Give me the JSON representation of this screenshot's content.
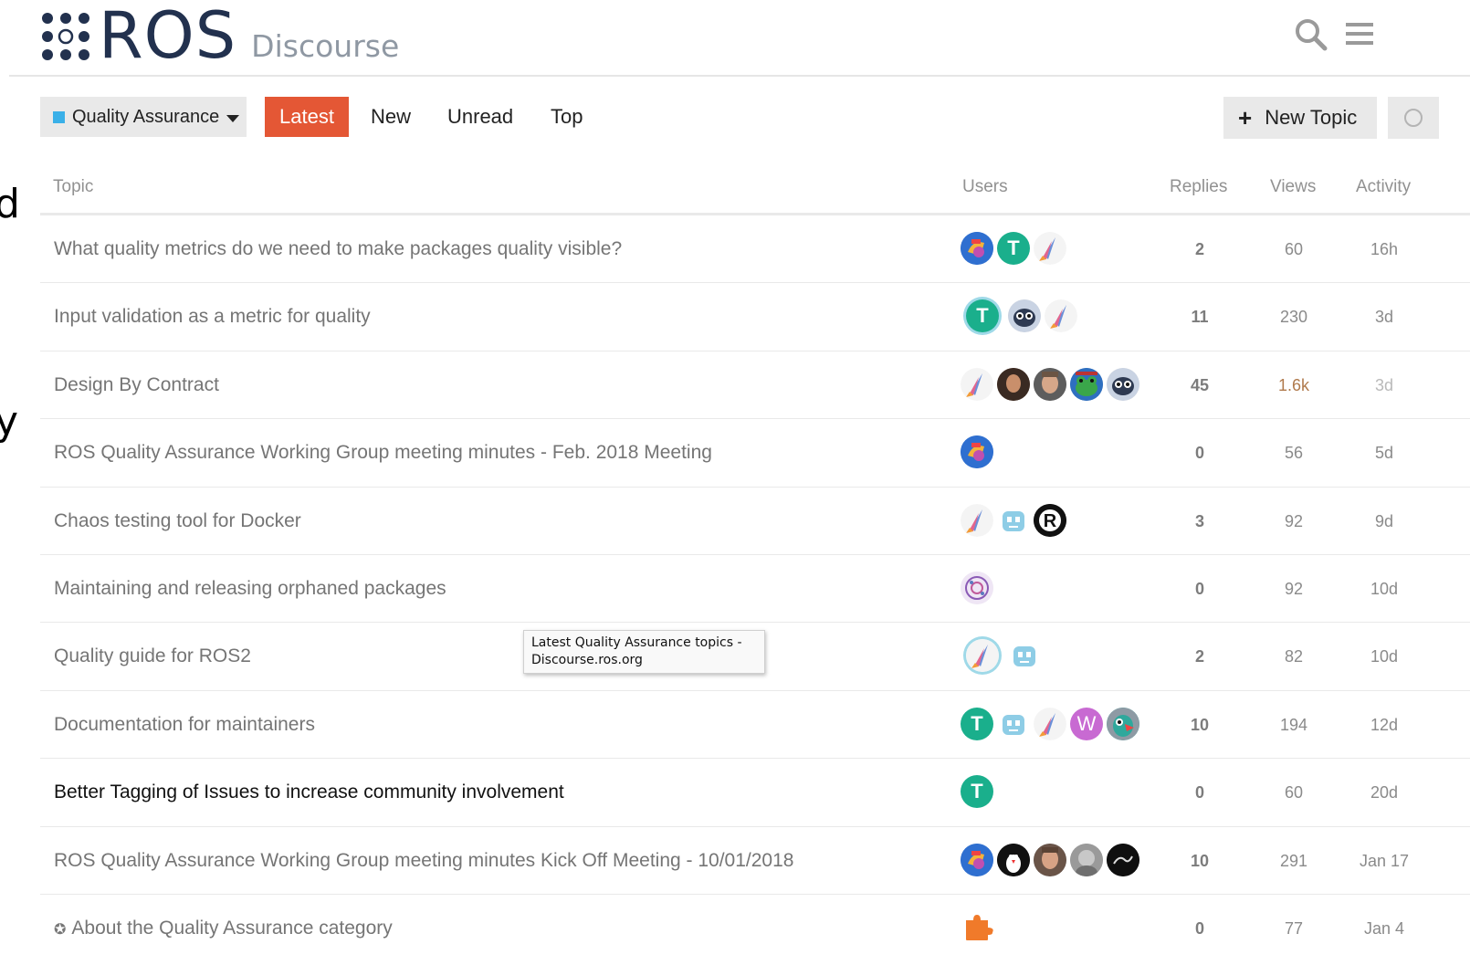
{
  "header": {
    "logo_text": "ROS",
    "logo_subtext": "Discourse",
    "search_icon": "search-icon",
    "menu_icon": "hamburger-menu-icon"
  },
  "nav": {
    "category": {
      "label": "Quality Assurance",
      "color": "#3ab0e8"
    },
    "tabs": [
      "Latest",
      "New",
      "Unread",
      "Top"
    ],
    "active_tab": "Latest",
    "active_color": "#e45735",
    "new_topic_label": "New Topic"
  },
  "table": {
    "headers": {
      "topic": "Topic",
      "users": "Users",
      "replies": "Replies",
      "views": "Views",
      "activity": "Activity"
    },
    "rows": [
      {
        "title": "What quality metrics do we need to make packages quality visible?",
        "replies": "2",
        "views": "60",
        "activity": "16h",
        "avatars": [
          "bird",
          "T",
          "rocket"
        ]
      },
      {
        "title": "Input validation as a metric for quality",
        "replies": "11",
        "views": "230",
        "activity": "3d",
        "avatars": [
          "T",
          "robot-face",
          "rocket"
        ]
      },
      {
        "title": "Design By Contract",
        "replies": "45",
        "views": "1.6k",
        "activity": "3d",
        "avatars": [
          "rocket",
          "person-dark",
          "person",
          "frog",
          "robot-face"
        ]
      },
      {
        "title": "ROS Quality Assurance Working Group meeting minutes - Feb. 2018 Meeting",
        "replies": "0",
        "views": "56",
        "activity": "5d",
        "avatars": [
          "bird"
        ]
      },
      {
        "title": "Chaos testing tool for Docker",
        "replies": "3",
        "views": "92",
        "activity": "9d",
        "avatars": [
          "rocket",
          "bot",
          "R"
        ]
      },
      {
        "title": "Maintaining and releasing orphaned packages",
        "replies": "0",
        "views": "92",
        "activity": "10d",
        "avatars": [
          "pattern"
        ]
      },
      {
        "title": "Quality guide for ROS2",
        "replies": "2",
        "views": "82",
        "activity": "10d",
        "avatars": [
          "rocket",
          "bot"
        ]
      },
      {
        "title": "Documentation for maintainers",
        "replies": "10",
        "views": "194",
        "activity": "12d",
        "avatars": [
          "T",
          "bot",
          "rocket",
          "W",
          "parrot"
        ]
      },
      {
        "title": "Better Tagging of Issues to increase community involvement",
        "replies": "0",
        "views": "60",
        "activity": "20d",
        "avatars": [
          "T"
        ]
      },
      {
        "title": "ROS Quality Assurance Working Group meeting minutes Kick Off Meeting - 10/01/2018",
        "replies": "10",
        "views": "291",
        "activity": "Jan 17",
        "avatars": [
          "bird",
          "penguin",
          "person",
          "person-gray",
          "dark"
        ]
      },
      {
        "title": "About the Quality Assurance category",
        "replies": "0",
        "views": "77",
        "activity": "Jan 4",
        "avatars": [
          "puzzle"
        ],
        "pinned": true
      }
    ]
  },
  "tooltip": {
    "line1": "Latest Quality Assurance topics -",
    "line2": "Discourse.ros.org"
  }
}
